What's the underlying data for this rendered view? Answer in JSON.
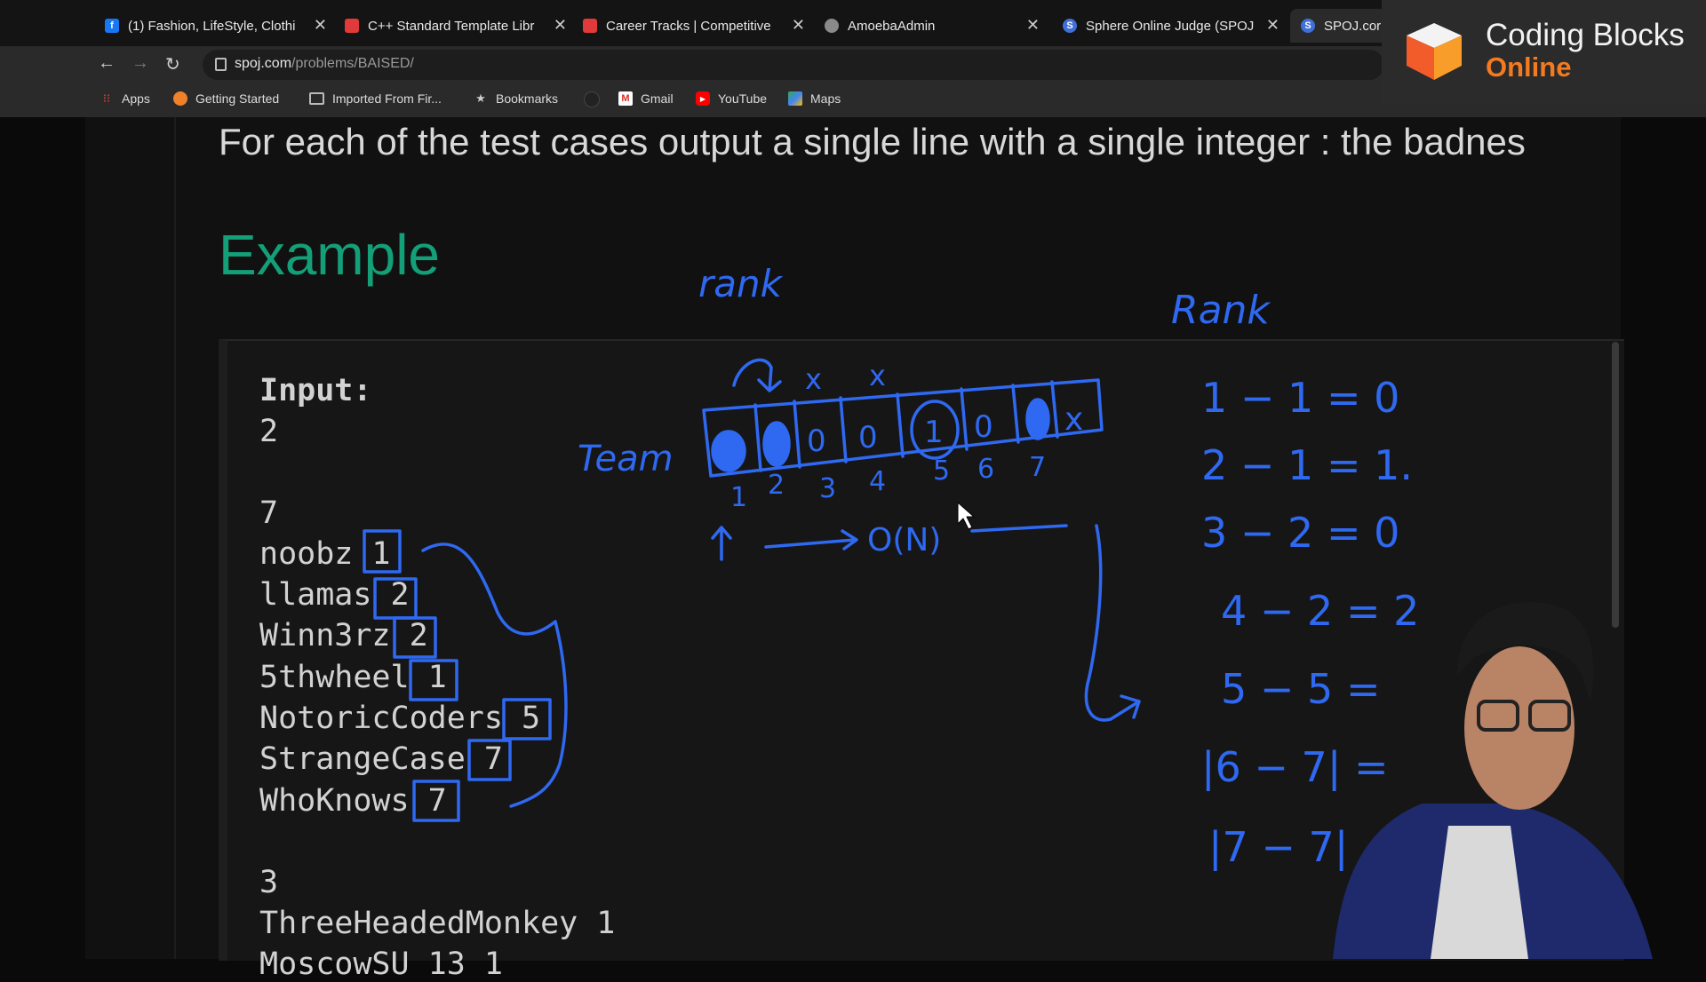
{
  "tabs": [
    {
      "title": "(1) Fashion, LifeStyle, Clothi",
      "fav_color": "#1877f2",
      "fav_glyph": "f",
      "icon": "facebook-icon"
    },
    {
      "title": "C++ Standard Template Libr",
      "fav_color": "#e03a3a",
      "fav_glyph": "",
      "icon": "coding-blocks-icon"
    },
    {
      "title": "Career Tracks | Competitive",
      "fav_color": "#e03a3a",
      "fav_glyph": "",
      "icon": "coding-blocks-icon"
    },
    {
      "title": "AmoebaAdmin",
      "fav_color": "#8a8a8a",
      "fav_glyph": "",
      "icon": "globe-icon"
    },
    {
      "title": "Sphere Online Judge (SPOJ",
      "fav_color": "#3f6fd8",
      "fav_glyph": "S",
      "icon": "spoj-icon"
    },
    {
      "title": "SPOJ.cor",
      "fav_color": "#3f6fd8",
      "fav_glyph": "S",
      "icon": "spoj-icon"
    }
  ],
  "address": {
    "domain": "spoj.com",
    "path": "/problems/BAISED/"
  },
  "bookmarks": [
    {
      "label": "Apps",
      "icon": "apps-grid-icon"
    },
    {
      "label": "Getting Started",
      "icon": "firefox-icon"
    },
    {
      "label": "Imported From Fir...",
      "icon": "folder-icon"
    },
    {
      "label": "Bookmarks",
      "icon": "star-icon"
    },
    {
      "label": "",
      "icon": "github-icon"
    },
    {
      "label": "Gmail",
      "icon": "gmail-icon"
    },
    {
      "label": "YouTube",
      "icon": "youtube-icon"
    },
    {
      "label": "Maps",
      "icon": "maps-icon"
    }
  ],
  "logo": {
    "line1": "Coding Blocks",
    "line2": "Online"
  },
  "problem": {
    "output_text": "For each of the test cases output a single line with a single integer : the badnes",
    "example_heading": "Example",
    "input_label": "Input:",
    "lines": [
      "2",
      "",
      "7",
      "noobz 1",
      "llamas 2",
      "Winn3rz 2",
      "5thwheel 1",
      "NotoricCoders 5",
      "StrangeCase 7",
      "WhoKnows 7",
      "",
      "3",
      "ThreeHeadedMonkey 1",
      "MoscowSU 13 1"
    ]
  },
  "annotations": {
    "rank_small": "rank",
    "rank_big": "Rank",
    "team": "Team",
    "array_cells": [
      "o",
      "o",
      "0",
      "0",
      "1",
      "0",
      "x"
    ],
    "array_indices": [
      "1",
      "2",
      "3",
      "4",
      "5",
      "6",
      "7"
    ],
    "marks": [
      "x",
      "x"
    ],
    "complexity": "O(N)",
    "calc": [
      "1  − 1  =  0",
      "2  − 1  =  1.",
      "3  − 2  =  0",
      "4  − 2  =  2",
      "5  − 5  =",
      "|6  − 7| =",
      "|7  − 7|"
    ]
  },
  "accent_colors": {
    "example": "#13a079",
    "ink": "#2f69f2",
    "logo_online": "#f47a20"
  }
}
